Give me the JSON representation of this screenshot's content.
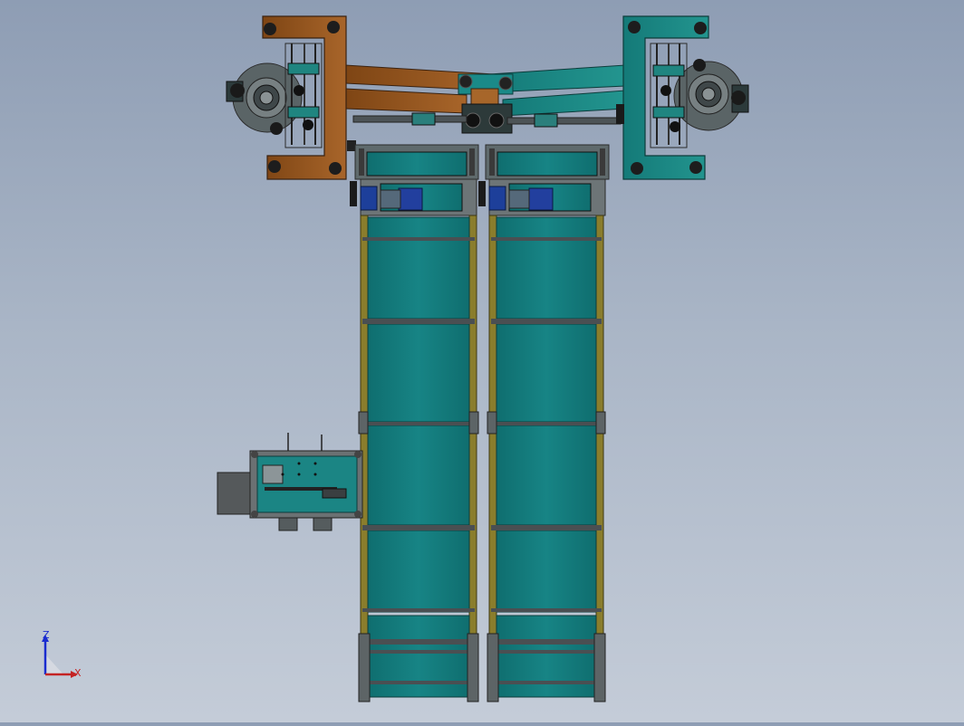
{
  "viewport": {
    "name": "cad-graphics-area",
    "background_top": "#8e9db4",
    "background_bottom": "#c4ccd8"
  },
  "colors": {
    "teal_belt": "#177f7f",
    "teal_frame": "#1f8f8c",
    "brown_arm": "#9a5a1e",
    "frame_gray": "#6b6e70",
    "rail_olive": "#8a7d2c",
    "motor_blue": "#1d3f9a",
    "dark": "#2b2b2b"
  },
  "triad": {
    "z_label": "Z",
    "x_label": "X",
    "z_color": "#1a2ccf",
    "x_color": "#c42323"
  }
}
